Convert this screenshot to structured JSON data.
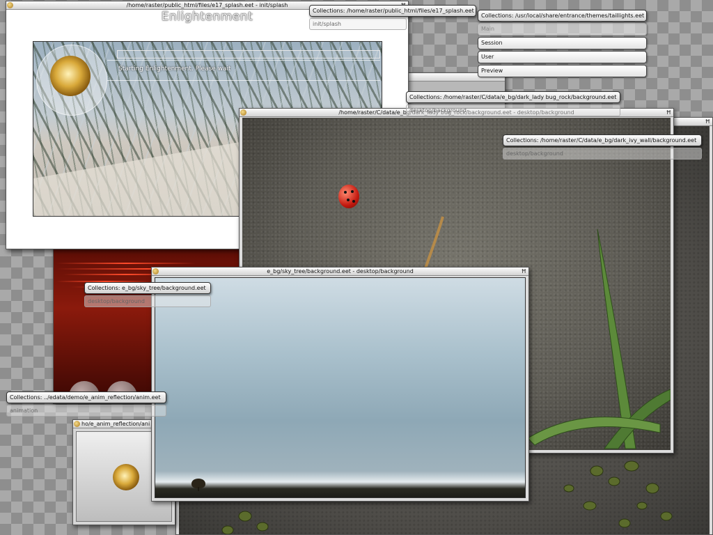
{
  "windows": {
    "splash": {
      "title": "/home/raster/public_html/files/e17_splash.eet - init/splash",
      "heading": "Enlightenment",
      "message": "Starting Enlightenment. Please wait",
      "progress": 0
    },
    "ladybug": {
      "title": "/home/raster/C/data/e_bg/dark_lady bug_rock/background.eet - desktop/background"
    },
    "sky": {
      "title": "e_bg/sky_tree/background.eet - desktop/background"
    },
    "anim": {
      "title": "ho/e_anim_reflection/ani"
    }
  },
  "collections": {
    "splash_eet": {
      "header": "Collections: /home/raster/public_html/files/e17_splash.eet",
      "items": [
        "init/splash"
      ]
    },
    "taillights": {
      "header": "Collections: /usr/local/share/entrance/themes/taillights.eet",
      "items": [
        "Main",
        "Session",
        "User",
        "Preview"
      ]
    },
    "ladybug_rock": {
      "header": "Collections: /home/raster/C/data/e_bg/dark_lady bug_rock/background.eet",
      "items": [
        "desktop/background"
      ]
    },
    "ivy_wall": {
      "header": "Collections: /home/raster/C/data/e_bg/dark_ivy_wall/background.eet",
      "items": [
        "desktop/background"
      ]
    },
    "sky_tree": {
      "header": "Collections: e_bg/sky_tree/background.eet",
      "items": [
        "desktop/background"
      ]
    },
    "anim_reflection": {
      "header": "Collections: ../edata/demo/e_anim_reflection/anim.eet",
      "items": [
        "animation"
      ]
    }
  }
}
